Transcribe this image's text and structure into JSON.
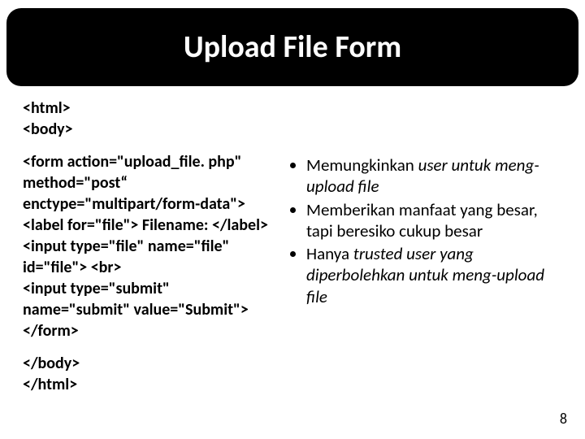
{
  "title": "Upload File Form",
  "code": {
    "top": "<html>\n<body>",
    "mid": "<form action=\"upload_file. php\" method=\"post“ enctype=\"multipart/form-data\">\n<label for=\"file\"> Filename: </label>\n<input type=\"file\" name=\"file\" id=\"file\"> <br>\n<input type=\"submit\" name=\"submit\" value=\"Submit\"> </form>",
    "bot": "</body>\n</html>"
  },
  "bullets": [
    {
      "pre": "Memungkinkan ",
      "it": "user untuk meng-upload file",
      "post": ""
    },
    {
      "pre": "Memberikan manfaat yang besar, tapi beresiko cukup besar",
      "it": "",
      "post": ""
    },
    {
      "pre": "Hanya ",
      "it": "trusted user yang diperbolehkan untuk meng-upload file",
      "post": ""
    }
  ],
  "page": "8"
}
